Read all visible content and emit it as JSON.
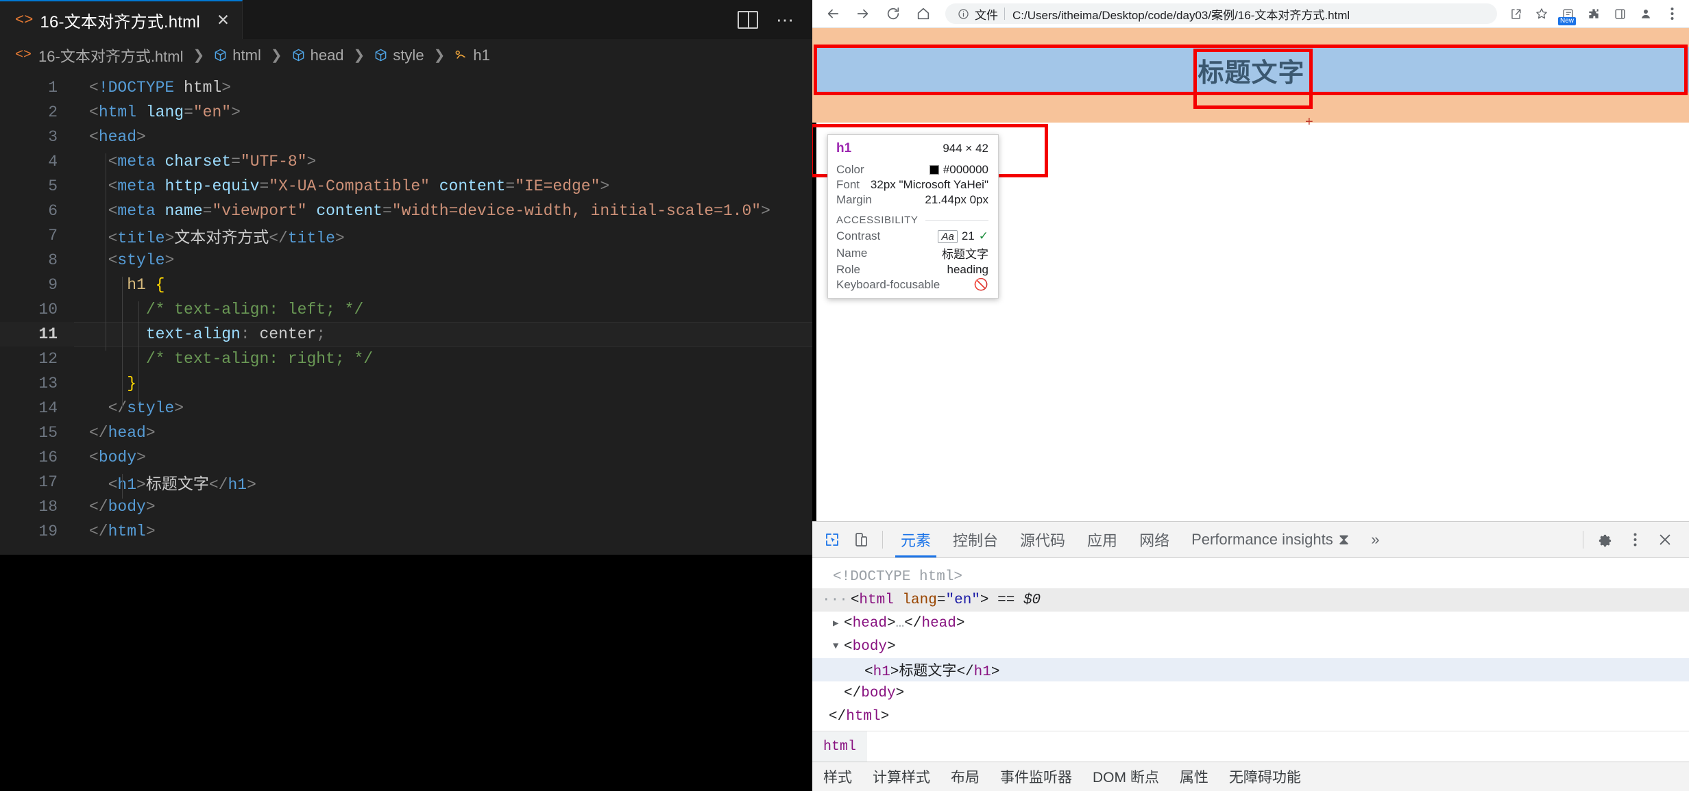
{
  "editor": {
    "tab": {
      "label": "16-文本对齐方式.html",
      "close": "✕",
      "icon": "html-file-icon"
    },
    "breadcrumb": [
      {
        "label": "16-文本对齐方式.html",
        "icon": "html-file-icon"
      },
      {
        "label": "html",
        "icon": "cube-icon"
      },
      {
        "label": "head",
        "icon": "cube-icon"
      },
      {
        "label": "style",
        "icon": "cube-icon"
      },
      {
        "label": "h1",
        "icon": "css-rule-icon"
      }
    ],
    "separator": "❯",
    "active_line": 11,
    "lines": [
      {
        "n": "1",
        "text": "<!DOCTYPE html>"
      },
      {
        "n": "2",
        "text": "<html lang=\"en\">"
      },
      {
        "n": "3",
        "text": "<head>"
      },
      {
        "n": "4",
        "text": "  <meta charset=\"UTF-8\">"
      },
      {
        "n": "5",
        "text": "  <meta http-equiv=\"X-UA-Compatible\" content=\"IE=edge\">"
      },
      {
        "n": "6",
        "text": "  <meta name=\"viewport\" content=\"width=device-width, initial-scale=1.0\">"
      },
      {
        "n": "7",
        "text": "  <title>文本对齐方式</title>"
      },
      {
        "n": "8",
        "text": "  <style>"
      },
      {
        "n": "9",
        "text": "    h1 {"
      },
      {
        "n": "10",
        "text": "      /* text-align: left; */"
      },
      {
        "n": "11",
        "text": "      text-align: center;"
      },
      {
        "n": "12",
        "text": "      /* text-align: right; */"
      },
      {
        "n": "13",
        "text": "    }"
      },
      {
        "n": "14",
        "text": "  </style>"
      },
      {
        "n": "15",
        "text": "</head>"
      },
      {
        "n": "16",
        "text": "<body>"
      },
      {
        "n": "17",
        "text": "  <h1>标题文字</h1>"
      },
      {
        "n": "18",
        "text": "</body>"
      },
      {
        "n": "19",
        "text": "</html>"
      }
    ]
  },
  "browser": {
    "nav": {
      "back": "back-arrow-icon",
      "forward": "forward-arrow-icon",
      "reload": "reload-icon",
      "home": "home-icon"
    },
    "omnibox": {
      "info_icon": "info-circle-icon",
      "scheme_label": "文件",
      "url": "C:/Users/itheima/Desktop/code/day03/案例/16-文本对齐方式.html"
    },
    "actions": [
      {
        "name": "share-icon",
        "glyph": "share"
      },
      {
        "name": "bookmark-star-icon",
        "glyph": "star"
      },
      {
        "name": "reading-list-icon",
        "glyph": "new",
        "badge": "New"
      },
      {
        "name": "extensions-puzzle-icon",
        "glyph": "puzzle"
      },
      {
        "name": "side-panel-icon",
        "glyph": "panel"
      },
      {
        "name": "profile-avatar-icon",
        "glyph": "avatar"
      },
      {
        "name": "chrome-menu-icon",
        "glyph": "kebab"
      }
    ],
    "page": {
      "heading": "标题文字",
      "margin_color": "#f7c39a",
      "content_color": "#a3c6e8",
      "heading_color": "#3b5870",
      "highlight_color": "#f40000"
    },
    "inspect_tooltip": {
      "tag": "h1",
      "size": "944 × 42",
      "rows": [
        {
          "key": "Color",
          "value": "#000000",
          "swatch": "#000000"
        },
        {
          "key": "Font",
          "value": "32px \"Microsoft YaHei\""
        },
        {
          "key": "Margin",
          "value": "21.44px 0px"
        }
      ],
      "accessibility_label": "ACCESSIBILITY",
      "a11y": [
        {
          "key": "Contrast",
          "chip": "Aa",
          "value": "21",
          "status": "pass"
        },
        {
          "key": "Name",
          "value": "标题文字"
        },
        {
          "key": "Role",
          "value": "heading"
        },
        {
          "key": "Keyboard-focusable",
          "value": "",
          "status": "no"
        }
      ]
    }
  },
  "devtools": {
    "left_icons": [
      {
        "name": "inspect-element-icon",
        "selected": true
      },
      {
        "name": "device-toolbar-icon",
        "selected": false
      }
    ],
    "tabs": [
      {
        "label": "元素",
        "active": true
      },
      {
        "label": "控制台",
        "active": false
      },
      {
        "label": "源代码",
        "active": false
      },
      {
        "label": "应用",
        "active": false
      },
      {
        "label": "网络",
        "active": false
      },
      {
        "label": "Performance insights",
        "active": false,
        "suffix": "⧗"
      }
    ],
    "overflow": "»",
    "right_icons": [
      {
        "name": "settings-gear-icon"
      },
      {
        "name": "devtools-more-icon"
      },
      {
        "name": "close-devtools-icon"
      }
    ],
    "dom": [
      {
        "indent": 1,
        "arrow": "",
        "html": "doctype",
        "text": "<!DOCTYPE html>"
      },
      {
        "indent": 0,
        "arrow": "···",
        "html": "htmlroot",
        "text": "<html lang=\"en\"> == $0",
        "selected": true
      },
      {
        "indent": 1,
        "arrow": "▶",
        "html": "head",
        "text": "<head>…</head>"
      },
      {
        "indent": 1,
        "arrow": "▼",
        "html": "body",
        "text": "<body>"
      },
      {
        "indent": 2,
        "arrow": "",
        "html": "h1",
        "text": "<h1>标题文字</h1>",
        "highlighted": true
      },
      {
        "indent": 1,
        "arrow": "",
        "html": "bodyclose",
        "text": "</body>"
      },
      {
        "indent": 0,
        "arrow": "",
        "html": "htmlclose",
        "text": "</html>"
      }
    ],
    "breadcrumb": [
      "html"
    ],
    "bottom_tabs": [
      "样式",
      "计算样式",
      "布局",
      "事件监听器",
      "DOM 断点",
      "属性",
      "无障碍功能"
    ]
  }
}
